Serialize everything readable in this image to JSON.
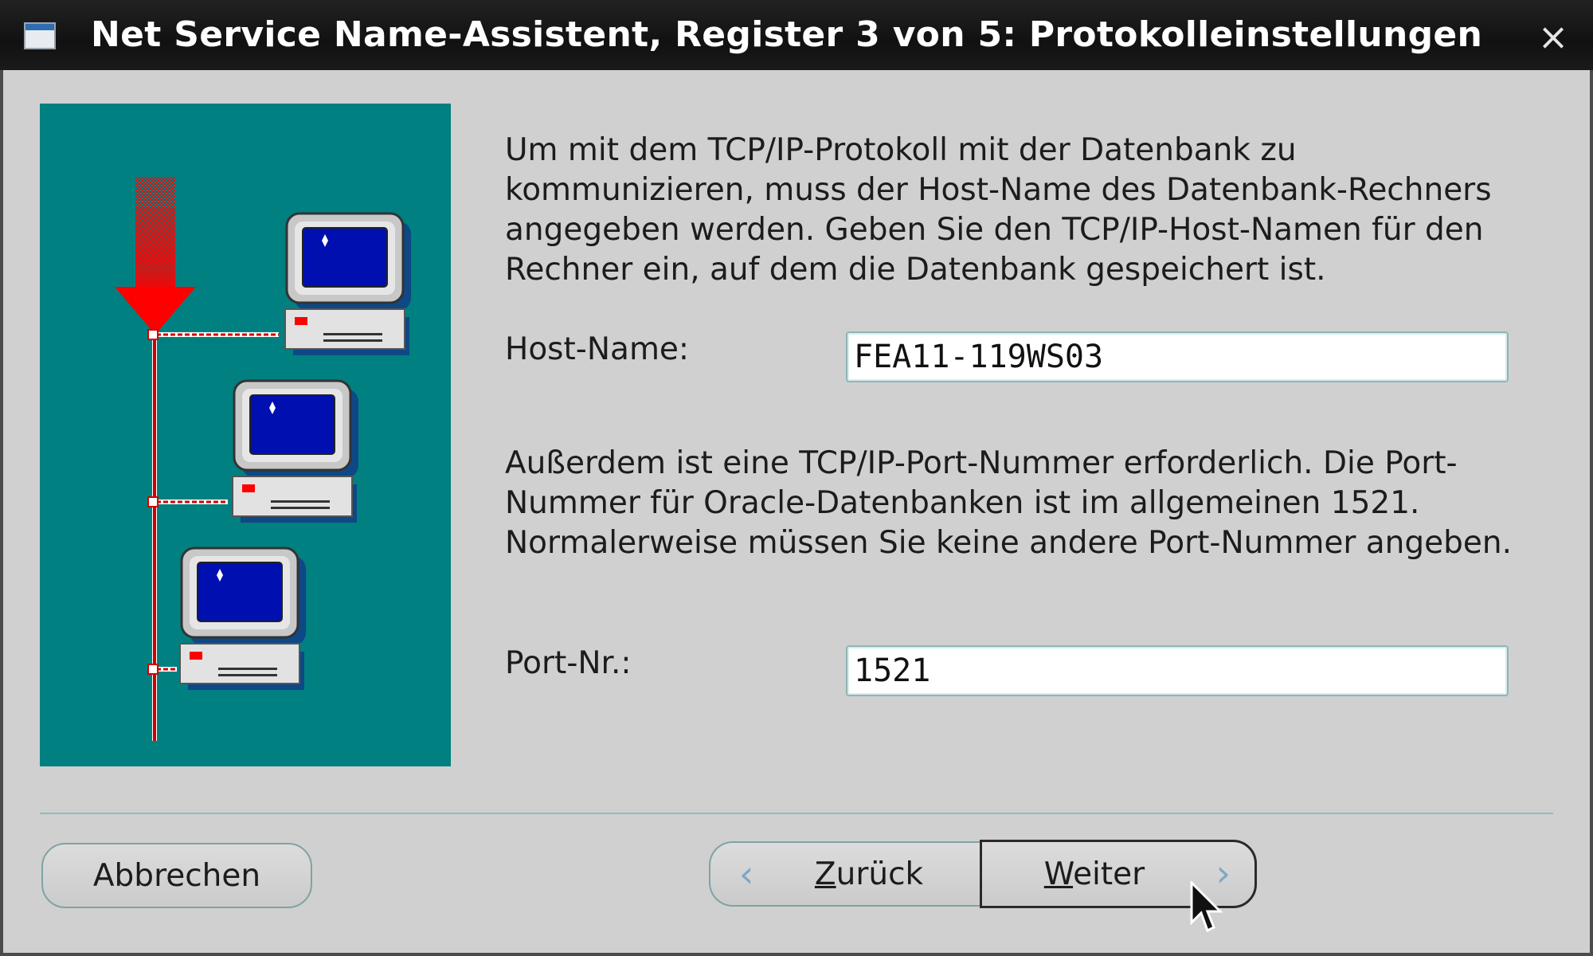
{
  "window": {
    "title": "Net Service Name-Assistent, Register 3 von 5: Protokolleinstellungen",
    "close_glyph": "×",
    "icons": [
      "window-icon",
      "close-icon",
      "network-illustration",
      "mouse-cursor-icon"
    ]
  },
  "content": {
    "intro_text": "Um mit dem TCP/IP-Protokoll mit der Datenbank zu\nkommunizieren, muss der Host-Name des Datenbank-Rechners\nangegeben werden. Geben Sie den TCP/IP-Host-Namen für den\nRechner ein, auf dem die Datenbank gespeichert ist.",
    "host_label": "Host-Name:",
    "host_value": "FEA11-119WS03",
    "port_text": "Außerdem ist eine TCP/IP-Port-Nummer erforderlich. Die Port-\nNummer für Oracle-Datenbanken ist im allgemeinen 1521.\nNormalerweise müssen Sie keine andere Port-Nummer angeben.",
    "port_label": "Port-Nr.:",
    "port_value": "1521"
  },
  "buttons": {
    "cancel": "Abbrechen",
    "back_mnemonic": "Z",
    "back_rest": "urück",
    "next_mnemonic": "W",
    "next_rest": "eiter",
    "back_chevron": "‹",
    "next_chevron": "›"
  },
  "colors": {
    "illustration_bg": "#008080",
    "title_bar": "#111111",
    "arrow": "#ff0000",
    "screen": "#0010b0"
  }
}
